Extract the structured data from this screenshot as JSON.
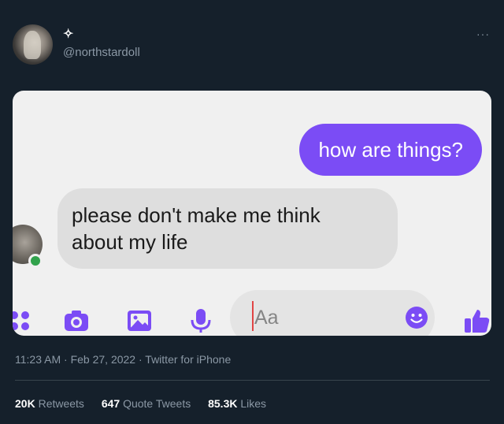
{
  "tweet": {
    "display_name": "✧",
    "handle": "@northstardoll",
    "more_label": "···",
    "timestamp": "11:23 AM",
    "date": "Feb 27, 2022",
    "source": "Twitter for iPhone",
    "separator": " · "
  },
  "chat": {
    "outgoing_message": "how are things?",
    "incoming_line1": "please don't make me think",
    "incoming_line2": "about my life",
    "composer_placeholder": "Aa",
    "colors": {
      "outgoing_bubble": "#7b4cf5",
      "incoming_bubble": "#dedede",
      "icon_accent": "#7b4cf5",
      "online": "#31a24c"
    },
    "icons": [
      "apps-icon",
      "camera-icon",
      "image-icon",
      "microphone-icon",
      "emoji-icon",
      "thumbs-up-icon"
    ]
  },
  "stats": {
    "retweets_count": "20K",
    "retweets_label": "Retweets",
    "quotes_count": "647",
    "quotes_label": "Quote Tweets",
    "likes_count": "85.3K",
    "likes_label": "Likes"
  },
  "colors": {
    "background": "#15202b",
    "muted_text": "#8b98a5",
    "divider": "#38444d"
  }
}
